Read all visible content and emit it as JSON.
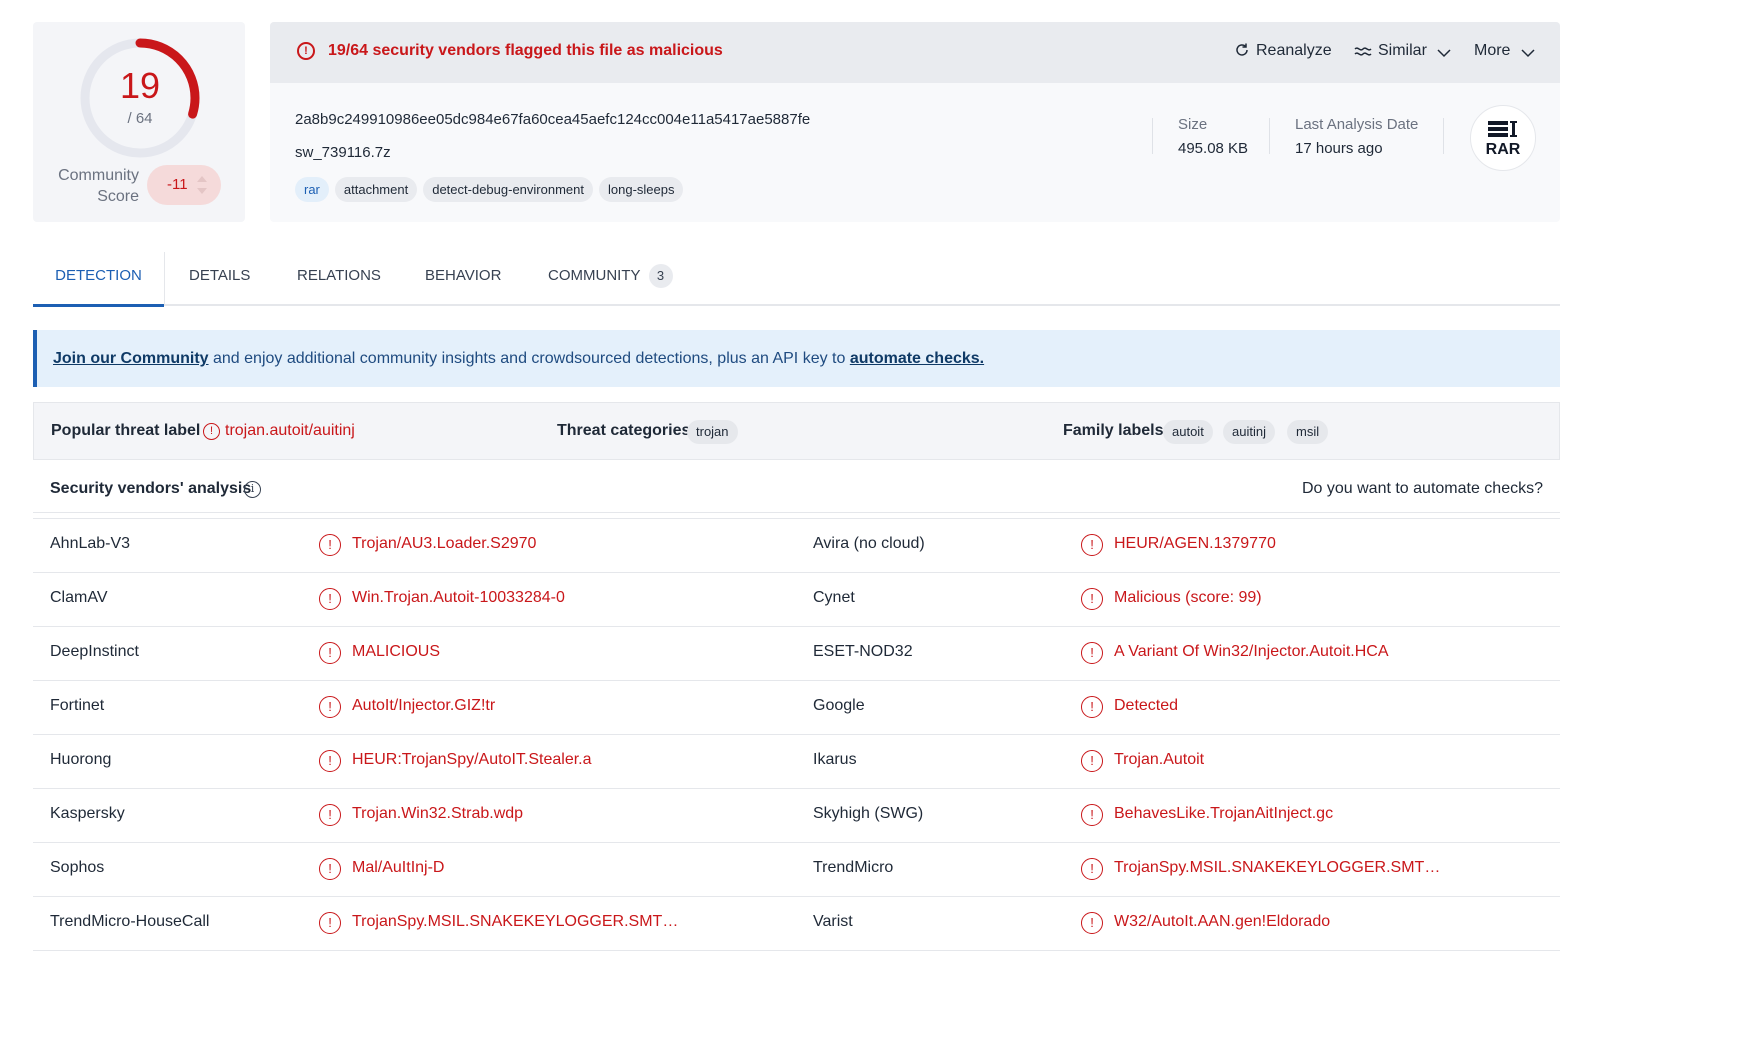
{
  "score": {
    "detections": "19",
    "total": "/ 64",
    "detection_fraction": 0.297,
    "community_label": "Community Score",
    "community_value": "-11",
    "accent_color": "#c9171a"
  },
  "header": {
    "alert": "19/64 security vendors flagged this file as malicious",
    "actions": {
      "reanalyze": "Reanalyze",
      "similar": "Similar",
      "more": "More"
    },
    "hash": "2a8b9c249910986ee05dc984e67fa60cea45aefc124cc004e11a5417ae5887fe",
    "filename": "sw_739116.7z",
    "tags": [
      "rar",
      "attachment",
      "detect-debug-environment",
      "long-sleeps"
    ],
    "size_label": "Size",
    "size_value": "495.08 KB",
    "date_label": "Last Analysis Date",
    "date_value": "17 hours ago",
    "file_type": "RAR"
  },
  "tabs": {
    "detection": "DETECTION",
    "details": "DETAILS",
    "relations": "RELATIONS",
    "behavior": "BEHAVIOR",
    "community": "COMMUNITY",
    "community_count": "3"
  },
  "banner": {
    "link1": "Join our Community",
    "middle": " and enjoy additional community insights and crowdsourced detections, plus an API key to ",
    "link2": "automate checks."
  },
  "threat": {
    "popular_label": "Popular threat label",
    "popular_value": "trojan.autoit/auitinj",
    "categories_label": "Threat categories",
    "categories": [
      "trojan"
    ],
    "family_label": "Family labels",
    "families": [
      "autoit",
      "auitinj",
      "msil"
    ]
  },
  "vendors": {
    "title": "Security vendors' analysis",
    "automate": "Do you want to automate checks?",
    "rows": [
      {
        "v1": "AhnLab-V3",
        "r1": "Trojan/AU3.Loader.S2970",
        "v2": "Avira (no cloud)",
        "r2": "HEUR/AGEN.1379770"
      },
      {
        "v1": "ClamAV",
        "r1": "Win.Trojan.Autoit-10033284-0",
        "v2": "Cynet",
        "r2": "Malicious (score: 99)"
      },
      {
        "v1": "DeepInstinct",
        "r1": "MALICIOUS",
        "v2": "ESET-NOD32",
        "r2": "A Variant Of Win32/Injector.Autoit.HCA"
      },
      {
        "v1": "Fortinet",
        "r1": "AutoIt/Injector.GIZ!tr",
        "v2": "Google",
        "r2": "Detected"
      },
      {
        "v1": "Huorong",
        "r1": "HEUR:TrojanSpy/AutoIT.Stealer.a",
        "v2": "Ikarus",
        "r2": "Trojan.Autoit"
      },
      {
        "v1": "Kaspersky",
        "r1": "Trojan.Win32.Strab.wdp",
        "v2": "Skyhigh (SWG)",
        "r2": "BehavesLike.TrojanAitInject.gc"
      },
      {
        "v1": "Sophos",
        "r1": "Mal/AuItInj-D",
        "v2": "TrendMicro",
        "r2": "TrojanSpy.MSIL.SNAKEKEYLOGGER.SMT…"
      },
      {
        "v1": "TrendMicro-HouseCall",
        "r1": "TrojanSpy.MSIL.SNAKEKEYLOGGER.SMT…",
        "v2": "Varist",
        "r2": "W32/AutoIt.AAN.gen!Eldorado"
      }
    ]
  }
}
